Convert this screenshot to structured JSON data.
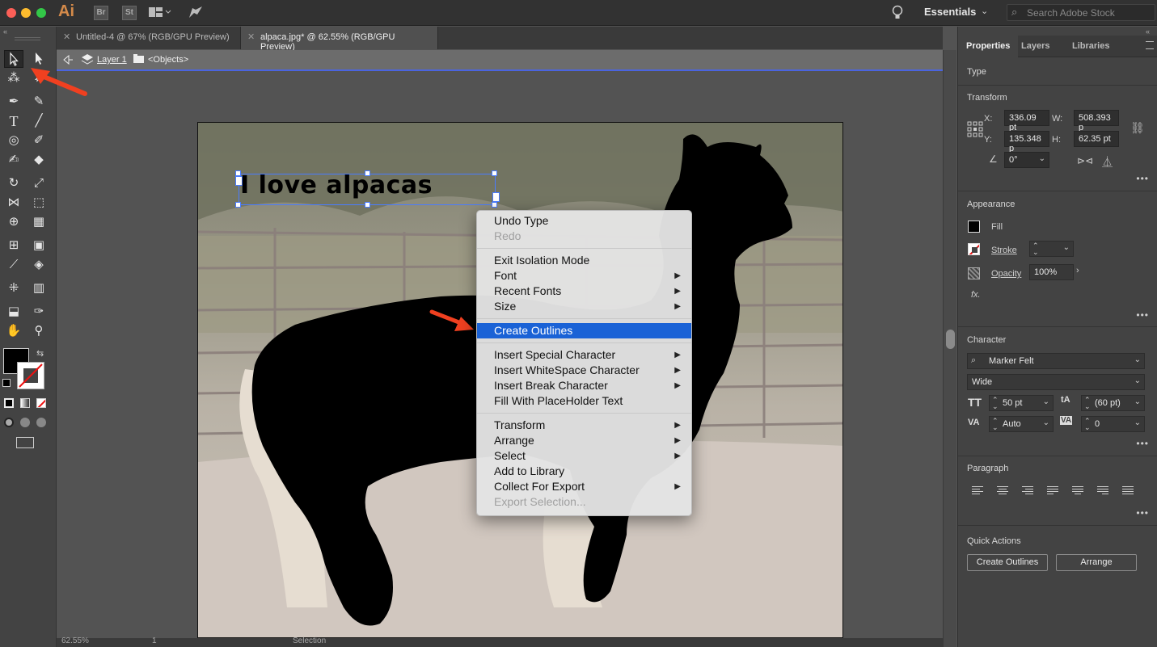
{
  "app": {
    "logo": "Ai",
    "bridge_btn": "Br",
    "stock_btn": "St",
    "workspace": "Essentials",
    "stock_search_placeholder": "Search Adobe Stock"
  },
  "tabs": [
    {
      "label": "Untitled-4 @ 67% (RGB/GPU Preview)",
      "active": false
    },
    {
      "label": "alpaca.jpg* @ 62.55% (RGB/GPU Preview)",
      "active": true
    }
  ],
  "isolation": {
    "layer": "Layer 1",
    "group": "<Objects>"
  },
  "canvas": {
    "text_object": "I love alpacas"
  },
  "context_menu": {
    "items": [
      {
        "label": "Undo Type",
        "disabled": false,
        "submenu": false
      },
      {
        "label": "Redo",
        "disabled": true,
        "submenu": false
      },
      {
        "sep": true
      },
      {
        "label": "Exit Isolation Mode",
        "disabled": false,
        "submenu": false
      },
      {
        "label": "Font",
        "disabled": false,
        "submenu": true
      },
      {
        "label": "Recent Fonts",
        "disabled": false,
        "submenu": true
      },
      {
        "label": "Size",
        "disabled": false,
        "submenu": true
      },
      {
        "sep": true
      },
      {
        "label": "Create Outlines",
        "disabled": false,
        "submenu": false,
        "highlighted": true
      },
      {
        "sep": true
      },
      {
        "label": "Insert Special Character",
        "disabled": false,
        "submenu": true
      },
      {
        "label": "Insert WhiteSpace Character",
        "disabled": false,
        "submenu": true
      },
      {
        "label": "Insert Break Character",
        "disabled": false,
        "submenu": true
      },
      {
        "label": "Fill With PlaceHolder Text",
        "disabled": false,
        "submenu": false
      },
      {
        "sep": true
      },
      {
        "label": "Transform",
        "disabled": false,
        "submenu": true
      },
      {
        "label": "Arrange",
        "disabled": false,
        "submenu": true
      },
      {
        "label": "Select",
        "disabled": false,
        "submenu": true
      },
      {
        "label": "Add to Library",
        "disabled": false,
        "submenu": false
      },
      {
        "label": "Collect For Export",
        "disabled": false,
        "submenu": true
      },
      {
        "label": "Export Selection...",
        "disabled": true,
        "submenu": false
      }
    ]
  },
  "panel": {
    "tabs": [
      "Properties",
      "Layers",
      "Libraries"
    ],
    "type_label": "Type",
    "transform": {
      "title": "Transform",
      "x_label": "X:",
      "x": "336.09 pt",
      "y_label": "Y:",
      "y": "135.348 p",
      "w_label": "W:",
      "w": "508.393 p",
      "h_label": "H:",
      "h": "62.35 pt",
      "angle": "0°"
    },
    "appearance": {
      "title": "Appearance",
      "fill": "Fill",
      "stroke": "Stroke",
      "opacity_label": "Opacity",
      "opacity": "100%",
      "fx": "fx."
    },
    "character": {
      "title": "Character",
      "font": "Marker Felt",
      "style": "Wide",
      "size": "50 pt",
      "leading": "(60 pt)",
      "kerning": "Auto",
      "tracking": "0"
    },
    "paragraph": {
      "title": "Paragraph"
    },
    "quick_actions": {
      "title": "Quick Actions",
      "btn1": "Create Outlines",
      "btn2": "Arrange"
    }
  },
  "status": {
    "zoom": "62.55%",
    "page": "1",
    "tool": "Selection"
  }
}
